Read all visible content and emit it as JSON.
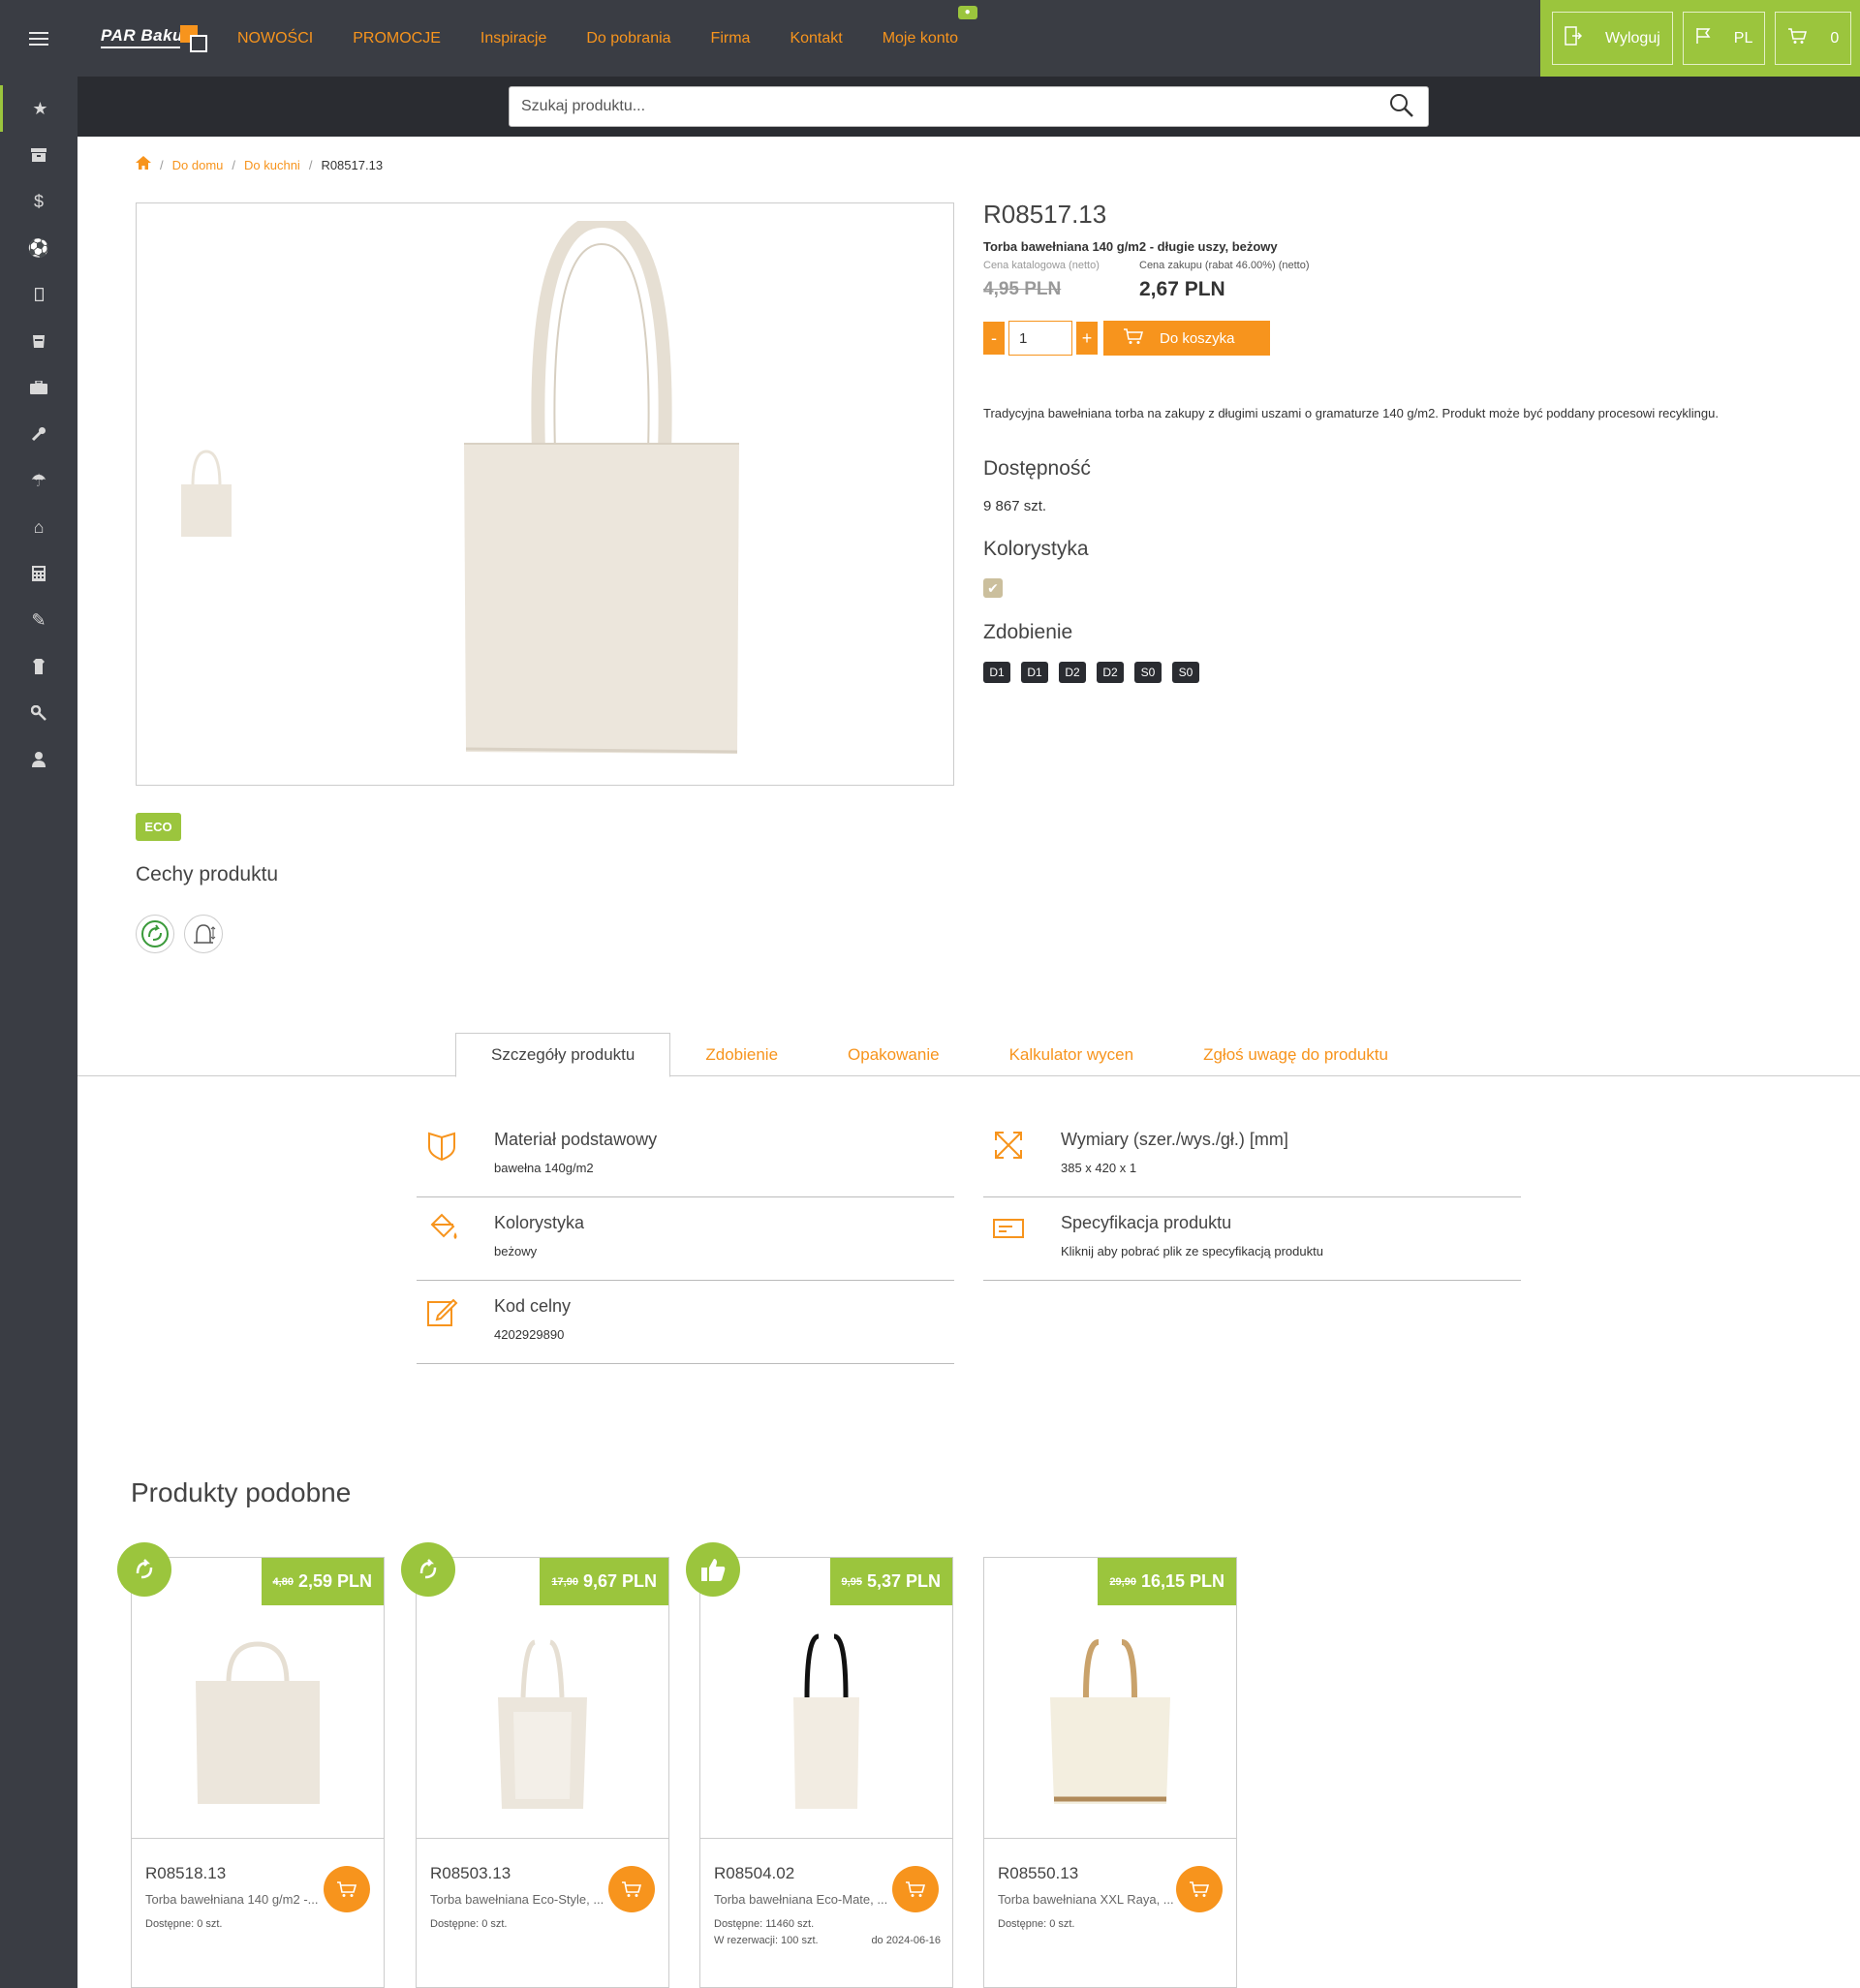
{
  "brand": {
    "logo_text": "PAR Bakuła"
  },
  "nav": {
    "items": [
      "NOWOŚCI",
      "PROMOCJE",
      "Inspiracje",
      "Do pobrania",
      "Firma",
      "Kontakt",
      "Moje konto"
    ]
  },
  "topright": {
    "logout_label": "Wyloguj",
    "lang_label": "PL",
    "cart_count": "0"
  },
  "search": {
    "placeholder": "Szukaj produktu..."
  },
  "sidebar_icons": [
    "star-icon",
    "archive-icon",
    "dollar-icon",
    "soccer-ball-icon",
    "phone-icon",
    "mug-icon",
    "briefcase-icon",
    "wrench-icon",
    "umbrella-icon",
    "home-icon",
    "calculator-icon",
    "edit-icon",
    "shirt-icon",
    "key-icon",
    "user-icon"
  ],
  "breadcrumb": {
    "items": [
      "Do domu",
      "Do kuchni"
    ],
    "current": "R08517.13"
  },
  "product": {
    "sku": "R08517.13",
    "name": "Torba bawełniana 140 g/m2 - długie uszy, beżowy",
    "catalog_price_label": "Cena katalogowa (netto)",
    "catalog_price": "4,95 PLN",
    "buy_price_label": "Cena zakupu (rabat 46.00%) (netto)",
    "buy_price": "2,67 PLN",
    "qty_minus": "-",
    "qty": "1",
    "qty_plus": "+",
    "cart_label": "Do koszyka",
    "description": "Tradycyjna bawełniana torba na zakupy z długimi uszami o gramaturze 140 g/m2. Produkt może być poddany procesowi recyklingu.",
    "availability_title": "Dostępność",
    "availability": "9 867 szt.",
    "colors_title": "Kolorystyka",
    "swatch_color": "#cbbf9d",
    "decoration_title": "Zdobienie",
    "decorations": [
      "D1",
      "D1",
      "D2",
      "D2",
      "S0",
      "S0"
    ],
    "eco_badge": "ECO",
    "features_title": "Cechy produktu"
  },
  "tabs": [
    "Szczegóły produktu",
    "Zdobienie",
    "Opakowanie",
    "Kalkulator wycen",
    "Zgłoś uwagę do produktu"
  ],
  "details": [
    {
      "label": "Materiał podstawowy",
      "value": "bawełna 140g/m2"
    },
    {
      "label": "Wymiary (szer./wys./gł.) [mm]",
      "value": "385 x 420 x 1"
    },
    {
      "label": "Kolorystyka",
      "value": "beżowy"
    },
    {
      "label": "Specyfikacja produktu",
      "value": "Kliknij aby pobrać plik ze specyfikacją produktu"
    },
    {
      "label": "Kod celny",
      "value": "4202929890"
    }
  ],
  "similar": {
    "title": "Produkty podobne",
    "cards": [
      {
        "old": "4,80",
        "price": "2,59 PLN",
        "sku": "R08518.13",
        "name": "Torba bawełniana 140 g/m2 -...",
        "stock": "Dostępne: 0 szt.",
        "badge": "recycle-icon"
      },
      {
        "old": "17,90",
        "price": "9,67 PLN",
        "sku": "R08503.13",
        "name": "Torba bawełniana Eco-Style, ...",
        "stock": "Dostępne: 0 szt.",
        "badge": "recycle-icon"
      },
      {
        "old": "9,95",
        "price": "5,37 PLN",
        "sku": "R08504.02",
        "name": "Torba bawełniana Eco-Mate, ...",
        "stock": "Dostępne: 11460 szt.",
        "reserve": "W rezerwacji: 100 szt.",
        "date": "do 2024-06-16",
        "badge": "thumbs-up-icon"
      },
      {
        "old": "29,90",
        "price": "16,15 PLN",
        "sku": "R08550.13",
        "name": "Torba bawełniana XXL Raya, ...",
        "stock": "Dostępne: 0 szt."
      }
    ]
  },
  "colors": {
    "accent": "#f7941d",
    "green": "#9bc53d",
    "dark": "#3a3d44"
  }
}
